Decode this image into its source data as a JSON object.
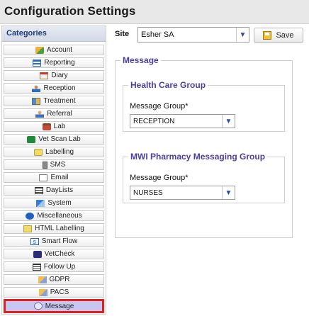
{
  "window": {
    "title": "Configuration Settings"
  },
  "sidebar": {
    "header": "Categories",
    "items": [
      {
        "label": "Account",
        "icon": "account-icon"
      },
      {
        "label": "Reporting",
        "icon": "reporting-icon"
      },
      {
        "label": "Diary",
        "icon": "diary-icon"
      },
      {
        "label": "Reception",
        "icon": "reception-icon"
      },
      {
        "label": "Treatment",
        "icon": "treatment-icon"
      },
      {
        "label": "Referral",
        "icon": "referral-icon"
      },
      {
        "label": "Lab",
        "icon": "lab-icon"
      },
      {
        "label": "Vet Scan Lab",
        "icon": "vet-scan-lab-icon"
      },
      {
        "label": "Labelling",
        "icon": "labelling-icon"
      },
      {
        "label": "SMS",
        "icon": "sms-icon"
      },
      {
        "label": "Email",
        "icon": "email-icon"
      },
      {
        "label": "DayLists",
        "icon": "daylists-icon"
      },
      {
        "label": "System",
        "icon": "system-icon"
      },
      {
        "label": "Miscellaneous",
        "icon": "miscellaneous-icon"
      },
      {
        "label": "HTML Labelling",
        "icon": "html-labelling-icon"
      },
      {
        "label": "Smart Flow",
        "icon": "smart-flow-icon"
      },
      {
        "label": "VetCheck",
        "icon": "vetcheck-icon"
      },
      {
        "label": "Follow Up",
        "icon": "follow-up-icon"
      },
      {
        "label": "GDPR",
        "icon": "gdpr-icon"
      },
      {
        "label": "PACS",
        "icon": "pacs-icon"
      },
      {
        "label": "Message",
        "icon": "message-icon",
        "selected": true
      }
    ]
  },
  "site": {
    "label": "Site",
    "value": "Esher SA"
  },
  "toolbar": {
    "save_label": "Save"
  },
  "message_section": {
    "legend": "Message",
    "health_care_group": {
      "legend": "Health Care Group",
      "field_label": "Message Group*",
      "value": "RECEPTION"
    },
    "mwi_group": {
      "legend": "MWI Pharmacy Messaging Group",
      "field_label": "Message Group*",
      "value": "NURSES"
    }
  },
  "colors": {
    "selection_outline": "#e01f1f",
    "selection_fill": "#c6c6f0",
    "legend_text": "#4a3ea0",
    "category_header_text": "#1e3d7a"
  }
}
